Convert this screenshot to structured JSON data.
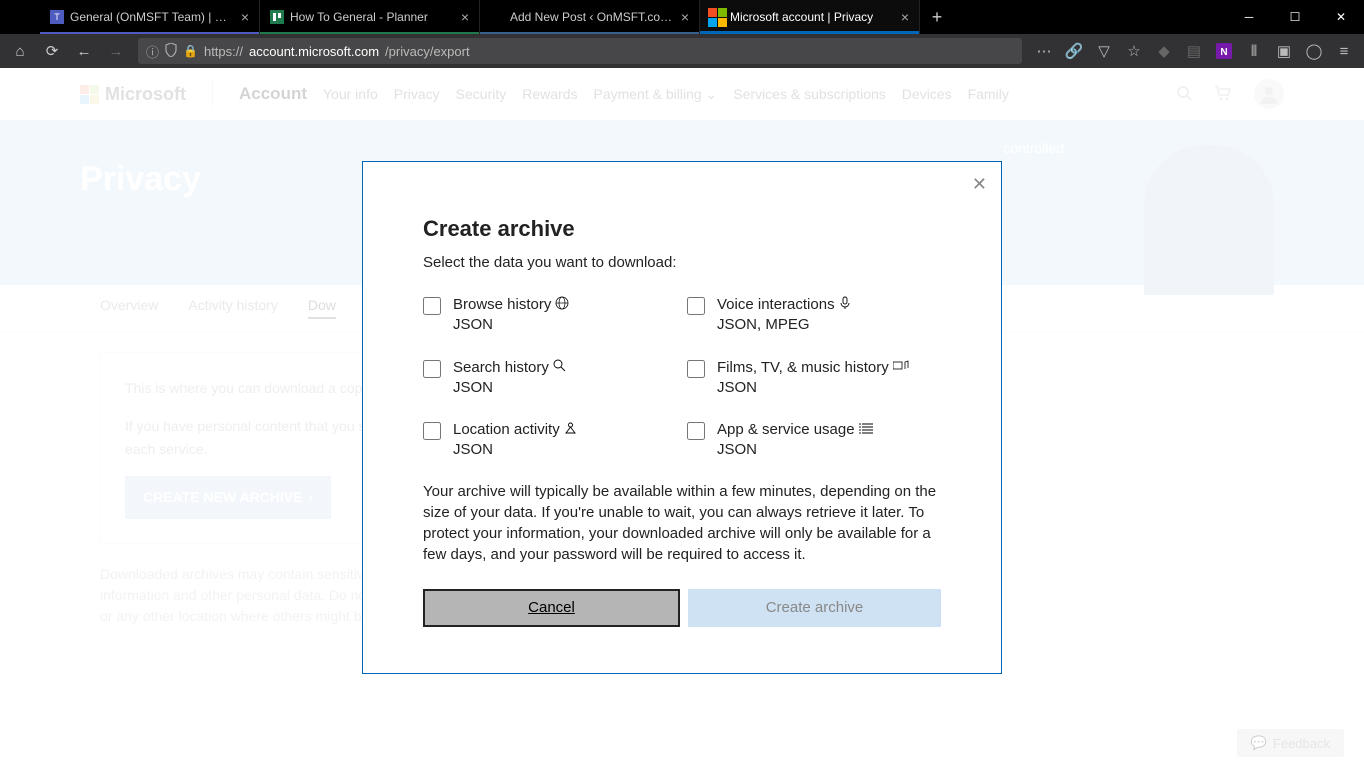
{
  "browser": {
    "tabs": [
      {
        "label": "General (OnMSFT Team) | Micr"
      },
      {
        "label": "How To General - Planner"
      },
      {
        "label": "Add New Post ‹ OnMSFT.com — W"
      },
      {
        "label": "Microsoft account | Privacy"
      }
    ],
    "url_prefix": "https://",
    "url_host": "account.microsoft.com",
    "url_path": "/privacy/export"
  },
  "header": {
    "brand": "Microsoft",
    "account": "Account",
    "nav": [
      "Your info",
      "Privacy",
      "Security",
      "Rewards",
      "Payment & billing",
      "Services & subscriptions",
      "Devices",
      "Family"
    ]
  },
  "hero": {
    "title": "Privacy",
    "speech": "controlled"
  },
  "subtabs": {
    "items": [
      "Overview",
      "Activity history",
      "Dow"
    ]
  },
  "card": {
    "p1": "This is where you can download a copy of the data on your activity history page.",
    "p2": "If you have personal content that you store with us – such as your email, calendar and photos – you can export it from each service.",
    "cta": "CREATE NEW ARCHIVE"
  },
  "disclaimer": "Downloaded archives may contain sensitive content, such as your search history, location information and other personal data. Do not download your archive to a public computer or any other location where others might be able to access it.",
  "feedback": "Feedback",
  "modal": {
    "title": "Create archive",
    "subtitle": "Select the data you want to download:",
    "options": [
      {
        "label": "Browse history",
        "format": "JSON"
      },
      {
        "label": "Voice interactions",
        "format": "JSON, MPEG"
      },
      {
        "label": "Search history",
        "format": "JSON"
      },
      {
        "label": "Films, TV, & music history",
        "format": "JSON"
      },
      {
        "label": "Location activity",
        "format": "JSON"
      },
      {
        "label": "App & service usage",
        "format": "JSON"
      }
    ],
    "paragraph": "Your archive will typically be available within a few minutes, depending on the size of your data. If you're unable to wait, you can always retrieve it later. To protect your information, your downloaded archive will only be available for a few days, and your password will be required to access it.",
    "cancel": "Cancel",
    "create": "Create archive"
  }
}
